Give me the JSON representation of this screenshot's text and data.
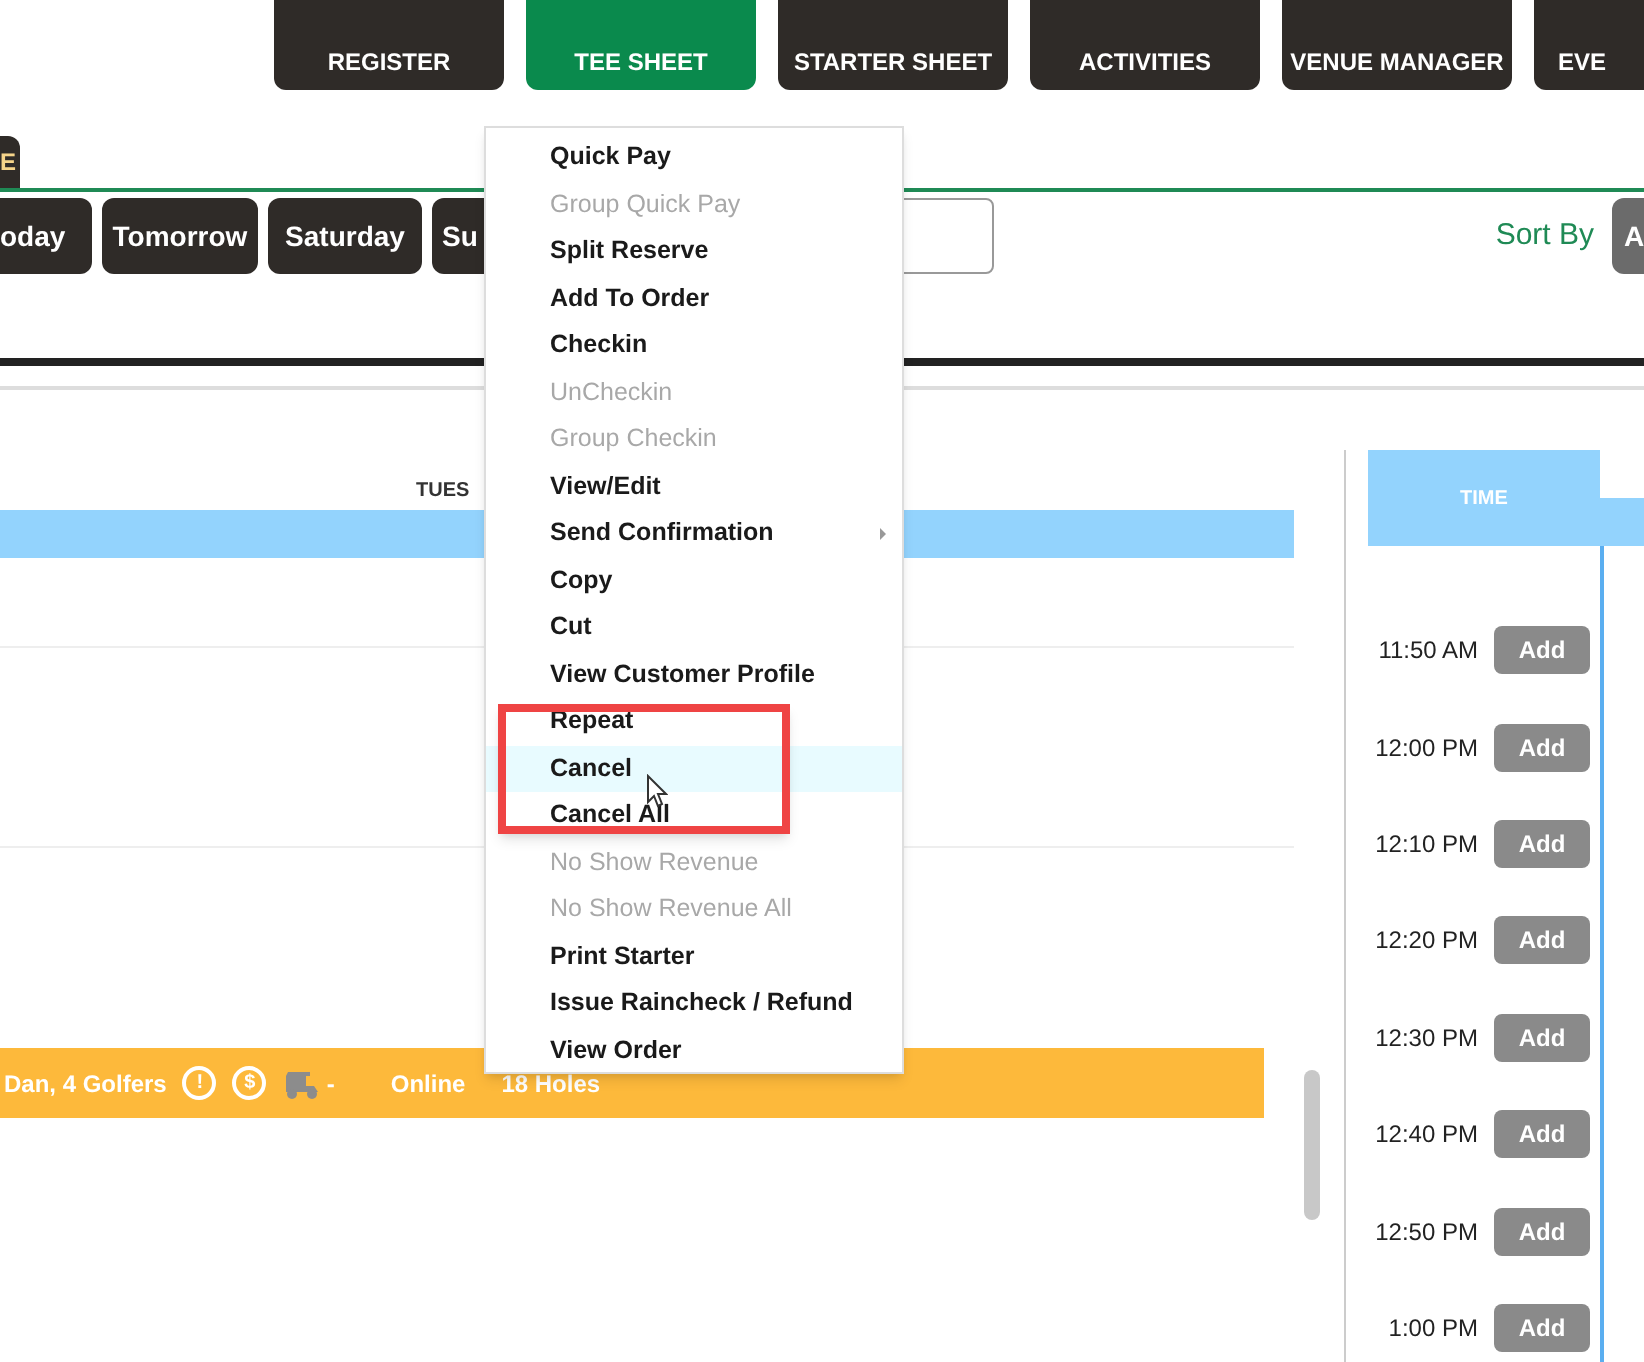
{
  "nav": [
    {
      "label": "REGISTER",
      "selected": false
    },
    {
      "label": "TEE SHEET",
      "selected": true
    },
    {
      "label": "STARTER SHEET",
      "selected": false
    },
    {
      "label": "ACTIVITIES",
      "selected": false
    },
    {
      "label": "VENUE MANAGER",
      "selected": false
    },
    {
      "label": "EVE",
      "selected": false
    }
  ],
  "tab": {
    "label": "E"
  },
  "date_buttons": [
    "oday",
    "Tomorrow",
    "Saturday",
    "Su"
  ],
  "sort": {
    "label": "Sort By",
    "button": "A"
  },
  "tee_sheet": {
    "day_header": "TUES",
    "booking": {
      "name": "Dan, 4 Golfers",
      "alert_icon": "!",
      "pay_icon": "$",
      "cart_text": "-",
      "source": "Online",
      "holes": "18 Holes"
    }
  },
  "time_column": {
    "header": "TIME",
    "slots": [
      {
        "time": "11:50 AM",
        "button": "Add"
      },
      {
        "time": "12:00 PM",
        "button": "Add"
      },
      {
        "time": "12:10 PM",
        "button": "Add"
      },
      {
        "time": "12:20 PM",
        "button": "Add"
      },
      {
        "time": "12:30 PM",
        "button": "Add"
      },
      {
        "time": "12:40 PM",
        "button": "Add"
      },
      {
        "time": "12:50 PM",
        "button": "Add"
      },
      {
        "time": "1:00 PM",
        "button": "Add"
      }
    ]
  },
  "context_menu": [
    {
      "label": "Quick Pay",
      "disabled": false,
      "selected": false
    },
    {
      "label": "Group Quick Pay",
      "disabled": true,
      "selected": false
    },
    {
      "label": "Split Reserve",
      "disabled": false,
      "selected": false
    },
    {
      "label": "Add To Order",
      "disabled": false,
      "selected": false
    },
    {
      "label": "Checkin",
      "disabled": false,
      "selected": false
    },
    {
      "label": "UnCheckin",
      "disabled": true,
      "selected": false
    },
    {
      "label": "Group Checkin",
      "disabled": true,
      "selected": false
    },
    {
      "label": "View/Edit",
      "disabled": false,
      "selected": false
    },
    {
      "label": "Send Confirmation",
      "disabled": false,
      "selected": false,
      "submenu": true
    },
    {
      "label": "Copy",
      "disabled": false,
      "selected": false
    },
    {
      "label": "Cut",
      "disabled": false,
      "selected": false
    },
    {
      "label": "View Customer Profile",
      "disabled": false,
      "selected": false
    },
    {
      "label": "Repeat",
      "disabled": false,
      "selected": false
    },
    {
      "label": "Cancel",
      "disabled": false,
      "selected": true
    },
    {
      "label": "Cancel All",
      "disabled": false,
      "selected": false
    },
    {
      "label": "No Show Revenue",
      "disabled": true,
      "selected": false
    },
    {
      "label": "No Show Revenue All",
      "disabled": true,
      "selected": false
    },
    {
      "label": "Print Starter",
      "disabled": false,
      "selected": false
    },
    {
      "label": "Issue Raincheck / Refund",
      "disabled": false,
      "selected": false
    },
    {
      "label": "View Order",
      "disabled": false,
      "selected": false
    }
  ]
}
